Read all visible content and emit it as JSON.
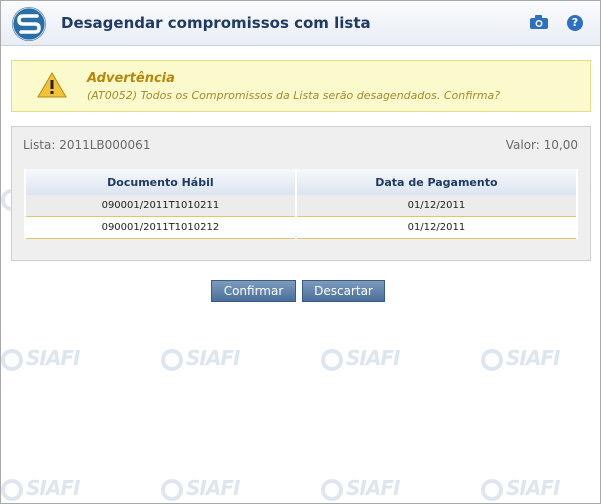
{
  "header": {
    "title": "Desagendar compromissos com lista",
    "help_label": "?"
  },
  "warning": {
    "title": "Advertência",
    "message": "(AT0052) Todos os Compromissos da Lista serão desagendados. Confirma?"
  },
  "lista": {
    "lista_text": "Lista: 2011LB000061",
    "valor_text": "Valor: 10,00",
    "columns": [
      "Documento Hábil",
      "Data de Pagamento"
    ],
    "rows": [
      [
        "090001/2011T1010211",
        "01/12/2011"
      ],
      [
        "090001/2011T1010212",
        "01/12/2011"
      ]
    ]
  },
  "actions": {
    "confirm_label": "Confirmar",
    "discard_label": "Descartar"
  },
  "watermark": {
    "text": "SIAFI"
  },
  "colors": {
    "title": "#1f3b64",
    "warning_bg": "#fbfacd",
    "warning_title": "#b8860b",
    "button": "#4a6f99",
    "row_border": "#e2c46a"
  }
}
